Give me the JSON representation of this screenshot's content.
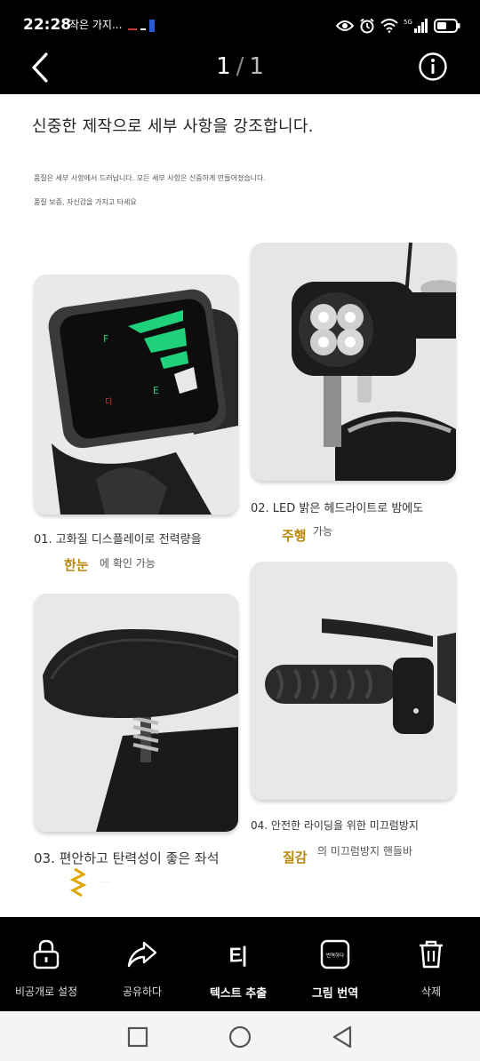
{
  "status_bar": {
    "time": "22:28",
    "notification_text": "작은 가지...",
    "network": "5G",
    "icons": [
      "eye-icon",
      "alarm-icon",
      "wifi-icon",
      "signal-icon",
      "battery-icon"
    ]
  },
  "top_bar": {
    "page_current": "1",
    "page_sep": "/",
    "page_total": "1",
    "icons": [
      "back-arrow-icon",
      "info-icon"
    ]
  },
  "content": {
    "heading": "신중한 제작으로 세부 사항을 강조합니다.",
    "subtext1": "품질은 세부 사항에서 드러납니다. 모든 세부 사항은 신중하게 만들어졌습니다.",
    "subtext2": "품질 보증, 자신감을 가지고 타세요",
    "features": [
      {
        "caption": "01. 고화질 디스플레이로 전력량을",
        "highlight": "한눈",
        "highlight_sub": "에 확인 가능"
      },
      {
        "caption": "02. LED 밝은 헤드라이트로 밤에도",
        "highlight": "주행",
        "highlight_sub": "가능"
      },
      {
        "caption": "03. 편안하고 탄력성이 좋은 좌석"
      },
      {
        "caption": "04. 안전한 라이딩을 위한 미끄럼방지",
        "highlight": "질감",
        "highlight_sub": "의 미끄럼방지 핸들바"
      }
    ],
    "display_letters": {
      "full": "F",
      "empty": "E",
      "mode": "디"
    },
    "accent_color": "#b8860b",
    "display_green": "#1fd17a"
  },
  "bottom_bar": {
    "actions": [
      {
        "label": "비공개로 설정",
        "icon": "lock-icon"
      },
      {
        "label": "공유하다",
        "icon": "share-icon"
      },
      {
        "label": "텍스트 추출",
        "icon": "text-extract-icon",
        "glyph": "티"
      },
      {
        "label": "그림 번역",
        "icon": "image-translate-icon",
        "badge": "번역하다"
      },
      {
        "label": "삭제",
        "icon": "trash-icon"
      }
    ]
  },
  "nav_bar": {
    "icons": [
      "recents-icon",
      "home-icon",
      "back-icon"
    ]
  }
}
